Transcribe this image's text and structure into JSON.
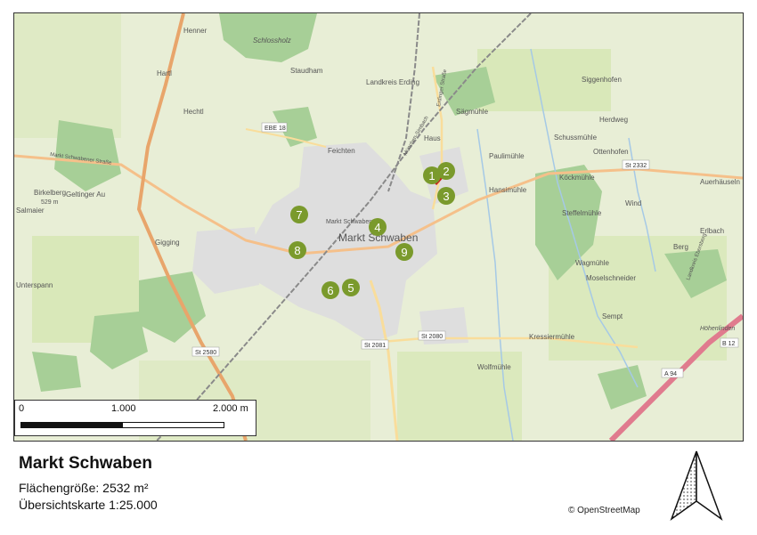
{
  "legend": {
    "title": "Markt Schwaben",
    "area_label": "Flächengröße: 2532 m²",
    "scale_label": "Übersichtskarte 1:25.000",
    "copyright": "© OpenStreetMap"
  },
  "scalebar": {
    "label_start": "0",
    "label_mid": "1.000",
    "label_end": "2.000 m"
  },
  "map": {
    "colors": {
      "background": "#e8eed6",
      "field": "#d9e8b9",
      "forest": "#a7cf97",
      "urban": "#dedede",
      "motorway": "#e07b8e",
      "primary": "#f5c08a",
      "railway": "#8a8a8a",
      "water": "#a5c9e6",
      "marker": "#7a9a2c"
    },
    "places": [
      "Henner",
      "Hartl",
      "Schlossholz",
      "Staudham",
      "Hechtl",
      "Feichten",
      "Landkreis Erding",
      "Sägmühle",
      "Haus",
      "Siggenhofen",
      "Herdweg",
      "Schussmühle",
      "Paulimühle",
      "Köckmühle",
      "Hansimühle",
      "Steffelmühle",
      "Auerhäuseln",
      "Erlbach",
      "Wind",
      "Berg",
      "Wagmühle",
      "Moselschneider",
      "Sempt",
      "Kressiermühle",
      "Wolfmühle",
      "Markt Schwaben",
      "Markt Schwaben",
      "Gigging",
      "Geltinger Au",
      "Birkelberg",
      "529 m",
      "Unterspann",
      "Salmaier",
      "Ottenhofen",
      "Höhenlinden",
      "München-Simbach",
      "Erdinger Straße",
      "Markt Schwabener Straße",
      "Landkreis Ebersberg"
    ],
    "road_refs": [
      "EBE 18",
      "St 2332",
      "St 2081",
      "St 2080",
      "St 2580",
      "A 94",
      "B 12"
    ],
    "markers": [
      "1",
      "2",
      "3",
      "4",
      "5",
      "6",
      "7",
      "8",
      "9"
    ]
  }
}
